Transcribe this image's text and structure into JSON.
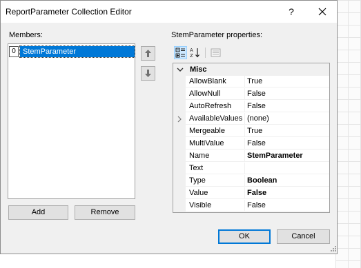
{
  "window": {
    "title": "ReportParameter Collection Editor",
    "help_label": "?",
    "close_icon": "close-icon"
  },
  "members": {
    "label": "Members:",
    "items": [
      {
        "index": "0",
        "name": "StemParameter",
        "selected": true
      }
    ],
    "move_up_icon": "arrow-up-icon",
    "move_down_icon": "arrow-down-icon",
    "add_label": "Add",
    "remove_label": "Remove"
  },
  "properties": {
    "label": "StemParameter properties:",
    "toolbar": [
      "categorized-icon",
      "alphabetical-sort-icon",
      "property-pages-icon"
    ],
    "category": "Misc",
    "rows": [
      {
        "name": "AllowBlank",
        "value": "True",
        "bold": false,
        "expandable": false
      },
      {
        "name": "AllowNull",
        "value": "False",
        "bold": false,
        "expandable": false
      },
      {
        "name": "AutoRefresh",
        "value": "False",
        "bold": false,
        "expandable": false
      },
      {
        "name": "AvailableValues",
        "value": "(none)",
        "bold": false,
        "expandable": true
      },
      {
        "name": "Mergeable",
        "value": "True",
        "bold": false,
        "expandable": false
      },
      {
        "name": "MultiValue",
        "value": "False",
        "bold": false,
        "expandable": false
      },
      {
        "name": "Name",
        "value": "StemParameter",
        "bold": true,
        "expandable": false
      },
      {
        "name": "Text",
        "value": "",
        "bold": false,
        "expandable": false
      },
      {
        "name": "Type",
        "value": "Boolean",
        "bold": true,
        "expandable": false
      },
      {
        "name": "Value",
        "value": "False",
        "bold": true,
        "expandable": false
      },
      {
        "name": "Visible",
        "value": "False",
        "bold": false,
        "expandable": false
      }
    ]
  },
  "footer": {
    "ok_label": "OK",
    "cancel_label": "Cancel"
  },
  "colors": {
    "selection": "#0078d7",
    "dialog_background": "#f0f0f0",
    "toolbar_active": "#cce8ff"
  }
}
